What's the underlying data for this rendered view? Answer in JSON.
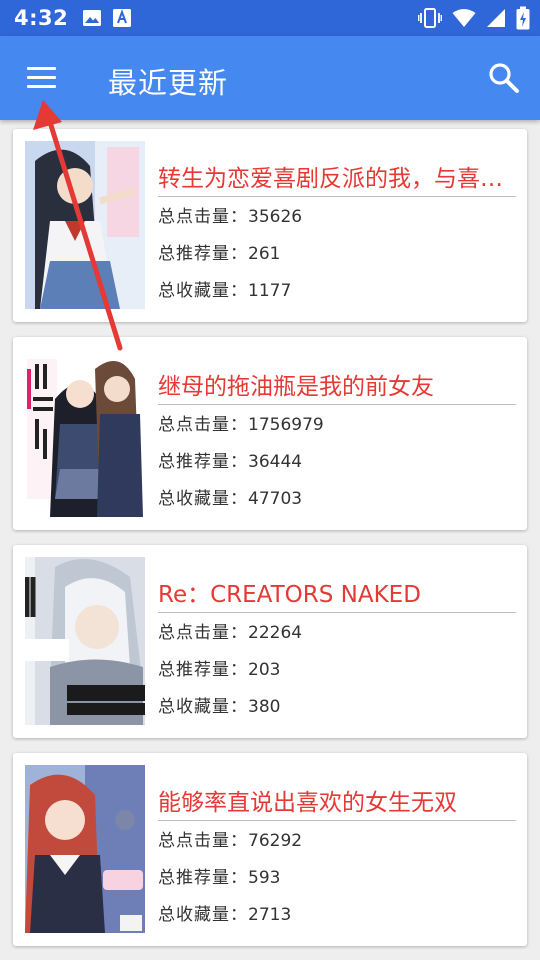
{
  "status_bar": {
    "time": "4:32"
  },
  "app_bar": {
    "title": "最近更新",
    "color": "#4488f0"
  },
  "labels": {
    "hits": "总点击量：",
    "recommends": "总推荐量：",
    "favorites": "总收藏量："
  },
  "books": [
    {
      "title": "转生为恋爱喜剧反派的我，与喜爱的女角",
      "hits": "35626",
      "recommends": "261",
      "favorites": "1177"
    },
    {
      "title": "继母的拖油瓶是我的前女友",
      "hits": "1756979",
      "recommends": "36444",
      "favorites": "47703"
    },
    {
      "title": "Re：CREATORS NAKED",
      "hits": "22264",
      "recommends": "203",
      "favorites": "380"
    },
    {
      "title": "能够率直说出喜欢的女生无双",
      "hits": "76292",
      "recommends": "593",
      "favorites": "2713"
    }
  ],
  "annotation": {
    "color": "#e53935"
  },
  "title_color": "#e53935"
}
